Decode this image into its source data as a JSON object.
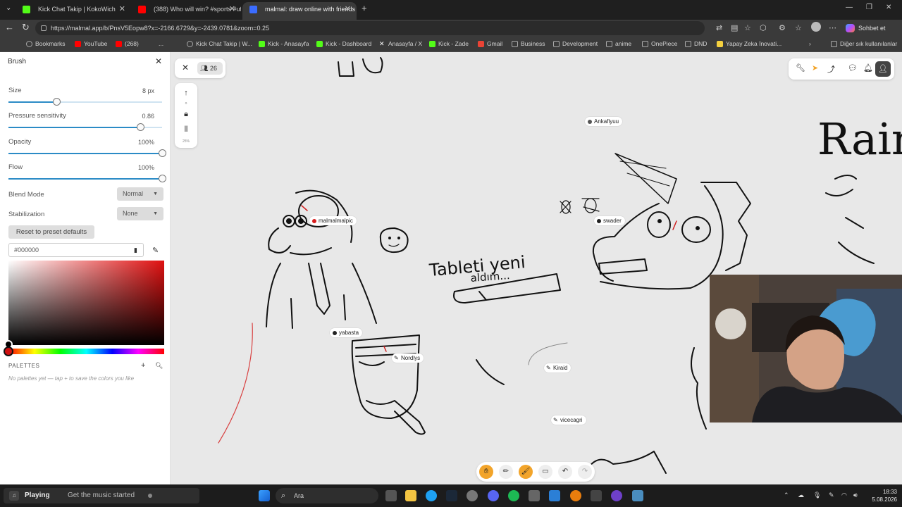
{
  "browser": {
    "tabs": [
      {
        "title": "Kick Chat Takip | KokoWich",
        "active": false,
        "color": "#53fc18"
      },
      {
        "title": "(388) Who will win? #sports #ufc #",
        "active": false,
        "color": "#ff0000"
      },
      {
        "title": "malmal: draw online with friends",
        "active": true,
        "color": "#3b6cff"
      }
    ],
    "url": "https://malmal.app/b/PnsV5Eopw8?x=-2166.6729&y=-2439.0781&zoom=0.25",
    "sohbet_label": "Sohbet et",
    "bookmarks": [
      {
        "label": "Bookmarks",
        "color": "#9aa0a6"
      },
      {
        "label": "YouTube",
        "color": "#ff0000"
      },
      {
        "label": "(268)",
        "color": "#ff0000"
      },
      {
        "label": "...",
        "color": ""
      },
      {
        "label": "Kick Chat Takip | W...",
        "color": "#9aa0a6"
      },
      {
        "label": "Kick - Anasayfa",
        "color": "#53fc18"
      },
      {
        "label": "Kick - Dashboard",
        "color": "#53fc18"
      },
      {
        "label": "Anasayfa / X",
        "color": "#ffffff"
      },
      {
        "label": "Kick - Zade",
        "color": "#53fc18"
      },
      {
        "label": "Gmail",
        "color": "#ea4335"
      },
      {
        "label": "Business",
        "color": "#9aa0a6"
      },
      {
        "label": "Development",
        "color": "#9aa0a6"
      },
      {
        "label": "anime",
        "color": "#9aa0a6"
      },
      {
        "label": "OnePiece",
        "color": "#9aa0a6"
      },
      {
        "label": "DND",
        "color": "#9aa0a6"
      },
      {
        "label": "Yapay Zeka İnovati...",
        "color": "#f4d03f"
      },
      {
        "label": "Diğer sık kullanılanlar",
        "color": "#9aa0a6"
      }
    ]
  },
  "brush_panel": {
    "title": "Brush",
    "size": {
      "label": "Size",
      "value": "8 px",
      "fraction": 0.31
    },
    "pressure": {
      "label": "Pressure sensitivity",
      "value": "0.86",
      "fraction": 0.86
    },
    "opacity": {
      "label": "Opacity",
      "value": "100%",
      "fraction": 1.0
    },
    "flow": {
      "label": "Flow",
      "value": "100%",
      "fraction": 1.0
    },
    "blend_mode": {
      "label": "Blend Mode",
      "value": "Normal"
    },
    "stabilization": {
      "label": "Stabilization",
      "value": "None"
    },
    "reset_label": "Reset to preset defaults",
    "hex": "#000000",
    "palettes_label": "PALETTES",
    "palettes_empty": "No palettes yet — tap + to save the colors you like"
  },
  "canvas": {
    "user_count": "26",
    "zoom_label": "25%",
    "users": [
      {
        "name": "Ankafiyuu",
        "kind": "dot",
        "color": "#555555"
      },
      {
        "name": "malmalmalpic",
        "kind": "dot",
        "color": "#d81e1e"
      },
      {
        "name": "swader",
        "kind": "dot",
        "color": "#222222"
      },
      {
        "name": "yabasta",
        "kind": "dot",
        "color": "#222222"
      },
      {
        "name": "Nordlys",
        "kind": "pen",
        "color": "#222222"
      },
      {
        "name": "Kiraid",
        "kind": "pen",
        "color": "#222222"
      },
      {
        "name": "vicecagri",
        "kind": "pen",
        "color": "#222222"
      }
    ],
    "drawn_text": {
      "tablet": "Tableti yeni",
      "aldim": "aldım...",
      "rain": "Rain"
    }
  },
  "taskbar": {
    "now_playing": "Playing",
    "music_prompt": "Get the music started",
    "search": "Ara",
    "time": "18:33",
    "date": "5.08.2026"
  },
  "colors": {
    "accent_tool": "#f2a42a",
    "slider": "#2b8bc6"
  }
}
